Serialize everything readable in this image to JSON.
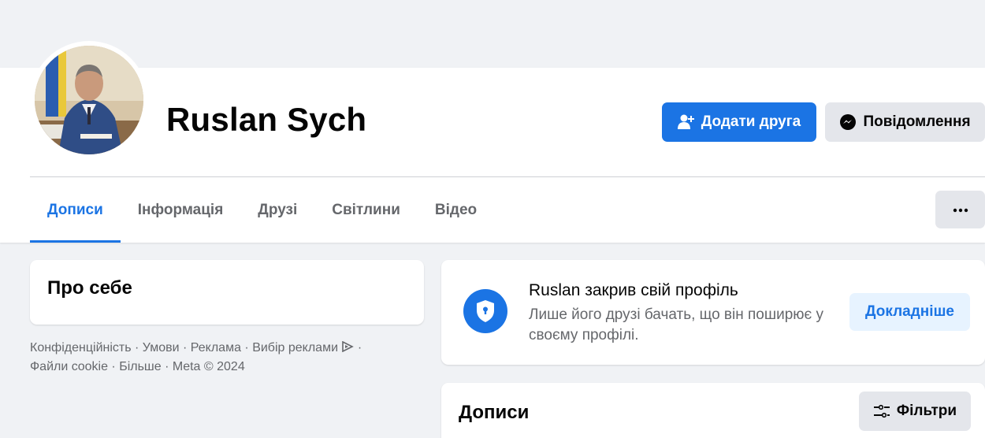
{
  "profile": {
    "name": "Ruslan Sych"
  },
  "actions": {
    "add_friend_label": "Додати друга",
    "message_label": "Повідомлення"
  },
  "tabs": [
    {
      "label": "Дописи",
      "active": true
    },
    {
      "label": "Інформація",
      "active": false
    },
    {
      "label": "Друзі",
      "active": false
    },
    {
      "label": "Світлини",
      "active": false
    },
    {
      "label": "Відео",
      "active": false
    }
  ],
  "about": {
    "title": "Про себе"
  },
  "footer": {
    "privacy": "Конфіденційність",
    "terms": "Умови",
    "ads": "Реклама",
    "ad_choices": "Вибір реклами",
    "cookies": "Файли cookie",
    "more": "Більше",
    "copyright": "Meta © 2024",
    "separator": " · "
  },
  "locked_profile": {
    "title": "Ruslan закрив свій профіль",
    "description": "Лише його друзі бачать, що він поширює у своєму профілі.",
    "learn_more_label": "Докладніше"
  },
  "posts": {
    "title": "Дописи",
    "filters_label": "Фільтри"
  },
  "colors": {
    "accent": "#1b74e4",
    "background": "#f0f2f5",
    "secondary_button": "#e4e6eb",
    "muted_text": "#65676b"
  },
  "icons": {
    "add_friend": "person-plus-icon",
    "message": "messenger-icon",
    "more": "more-dots-icon",
    "locked": "shield-keyhole-icon",
    "filters": "sliders-icon",
    "ad_choices": "ad-choices-icon"
  }
}
